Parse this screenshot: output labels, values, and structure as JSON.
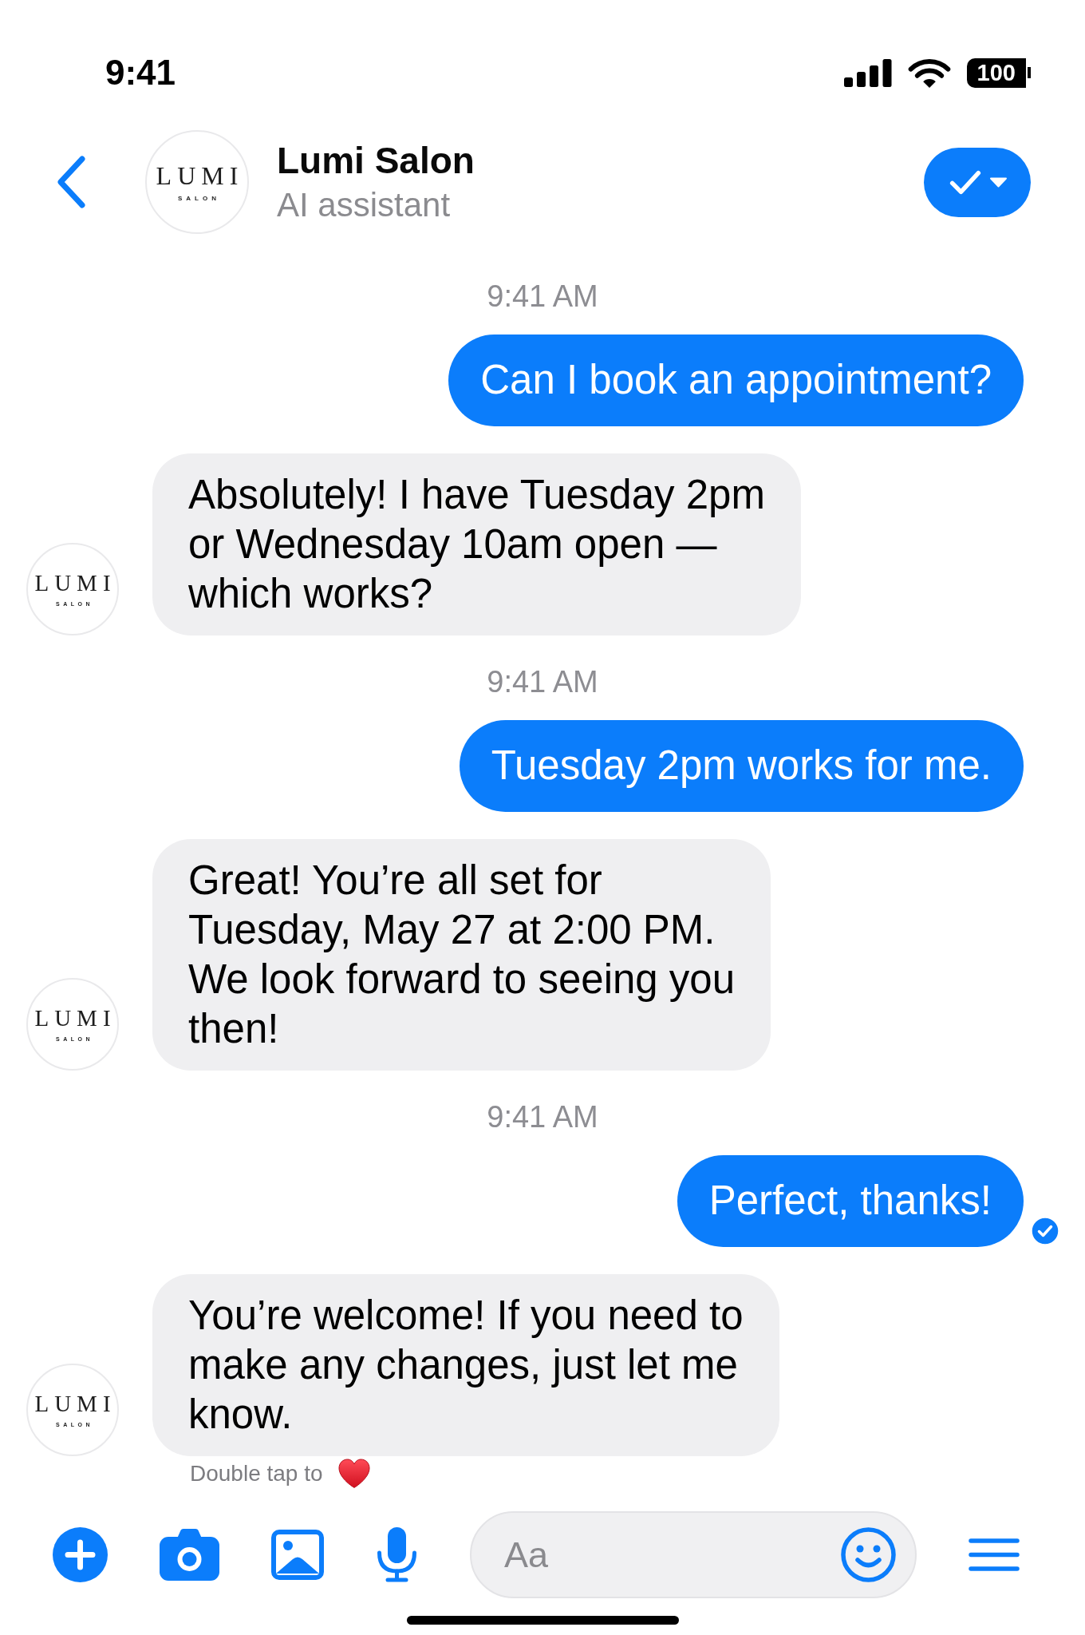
{
  "status_bar": {
    "time": "9:41",
    "battery": "100"
  },
  "header": {
    "avatar": {
      "wordmark": "LUMI",
      "tagline": "SALON"
    },
    "title": "Lumi Salon",
    "subtitle": "AI assistant"
  },
  "messages": [
    {
      "kind": "timestamp",
      "text": "9:41 AM"
    },
    {
      "kind": "outgoing",
      "text": "Can I book an appointment?",
      "read_receipt": false
    },
    {
      "kind": "incoming",
      "text": "Absolutely! I have Tuesday 2pm\nor Wednesday 10am open —\nwhich works?",
      "avatar": {
        "wordmark": "LUMI",
        "tagline": "SALON"
      }
    },
    {
      "kind": "timestamp",
      "text": "9:41 AM"
    },
    {
      "kind": "outgoing",
      "text": "Tuesday 2pm works for me.",
      "read_receipt": false
    },
    {
      "kind": "incoming",
      "text": "Great! You’re all set for\nTuesday, May 27 at 2:00 PM.\nWe look forward to seeing you\nthen!",
      "avatar": {
        "wordmark": "LUMI",
        "tagline": "SALON"
      }
    },
    {
      "kind": "timestamp",
      "text": "9:41 AM"
    },
    {
      "kind": "outgoing",
      "text": "Perfect, thanks!",
      "read_receipt": true
    },
    {
      "kind": "incoming",
      "text": "You’re welcome! If you need to\nmake any changes, just let me\nknow.",
      "avatar": {
        "wordmark": "LUMI",
        "tagline": "SALON"
      }
    }
  ],
  "reaction_hint": {
    "text": "Double tap to"
  },
  "composer": {
    "placeholder": "Aa"
  }
}
